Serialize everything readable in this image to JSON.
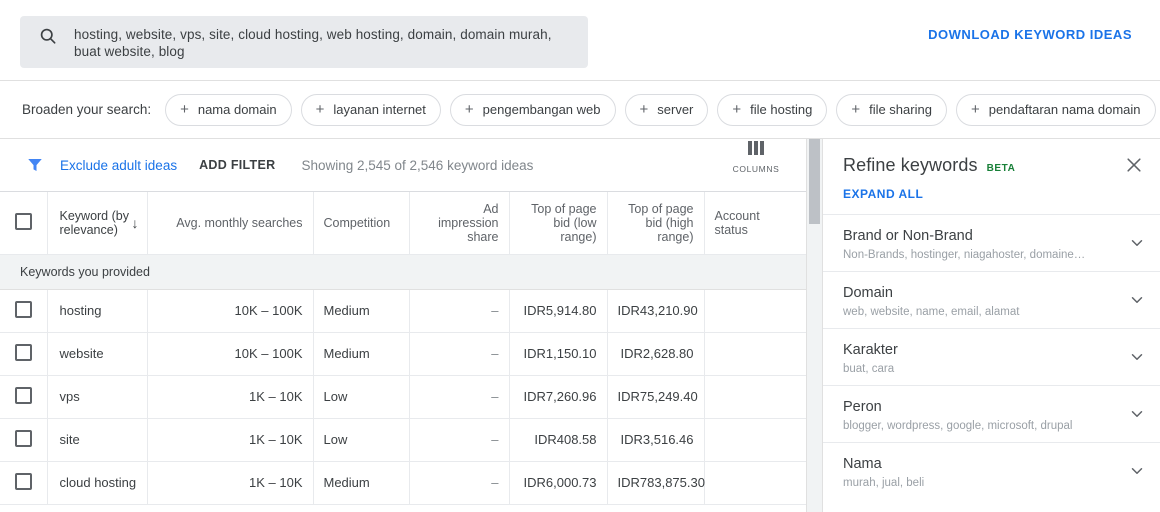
{
  "search": {
    "icon": "search-icon",
    "value": "hosting, website, vps, site, cloud hosting, web hosting, domain, domain murah, buat website, blog",
    "download_label": "DOWNLOAD KEYWORD IDEAS"
  },
  "broaden": {
    "label": "Broaden your search:",
    "chips": [
      {
        "label": "nama domain"
      },
      {
        "label": "layanan internet"
      },
      {
        "label": "pengembangan web"
      },
      {
        "label": "server"
      },
      {
        "label": "file hosting"
      },
      {
        "label": "file sharing"
      },
      {
        "label": "pendaftaran nama domain"
      }
    ]
  },
  "toolbar": {
    "filter_icon": "funnel-icon",
    "exclude_label": "Exclude adult ideas",
    "add_filter_label": "ADD FILTER",
    "showing_text": "Showing 2,545 of 2,546 keyword ideas",
    "columns_label": "COLUMNS"
  },
  "table": {
    "headers": {
      "keyword": "Keyword (by relevance)",
      "volume": "Avg. monthly searches",
      "competition": "Competition",
      "impression": "Ad impression share",
      "bid_low": "Top of page bid (low range)",
      "bid_high": "Top of page bid (high range)",
      "account": "Account status"
    },
    "group_label": "Keywords you provided",
    "rows": [
      {
        "keyword": "hosting",
        "volume": "10K – 100K",
        "competition": "Medium",
        "impression": "–",
        "bid_low": "IDR5,914.80",
        "bid_high": "IDR43,210.90",
        "account": ""
      },
      {
        "keyword": "website",
        "volume": "10K – 100K",
        "competition": "Medium",
        "impression": "–",
        "bid_low": "IDR1,150.10",
        "bid_high": "IDR2,628.80",
        "account": ""
      },
      {
        "keyword": "vps",
        "volume": "1K – 10K",
        "competition": "Low",
        "impression": "–",
        "bid_low": "IDR7,260.96",
        "bid_high": "IDR75,249.40",
        "account": ""
      },
      {
        "keyword": "site",
        "volume": "1K – 10K",
        "competition": "Low",
        "impression": "–",
        "bid_low": "IDR408.58",
        "bid_high": "IDR3,516.46",
        "account": ""
      },
      {
        "keyword": "cloud hosting",
        "volume": "1K – 10K",
        "competition": "Medium",
        "impression": "–",
        "bid_low": "IDR6,000.73",
        "bid_high": "IDR783,875.30",
        "account": ""
      }
    ]
  },
  "refine": {
    "title": "Refine keywords",
    "badge": "BETA",
    "expand_all": "EXPAND ALL",
    "items": [
      {
        "name": "Brand or Non-Brand",
        "sub": "Non-Brands, hostinger, niagahoster, domaine…"
      },
      {
        "name": "Domain",
        "sub": "web, website, name, email, alamat"
      },
      {
        "name": "Karakter",
        "sub": "buat, cara"
      },
      {
        "name": "Peron",
        "sub": "blogger, wordpress, google, microsoft, drupal"
      },
      {
        "name": "Nama",
        "sub": "murah, jual, beli"
      }
    ]
  },
  "colors": {
    "accent_blue": "#1a73e8",
    "beta_green": "#188038",
    "header_gray": "#5f6368"
  }
}
